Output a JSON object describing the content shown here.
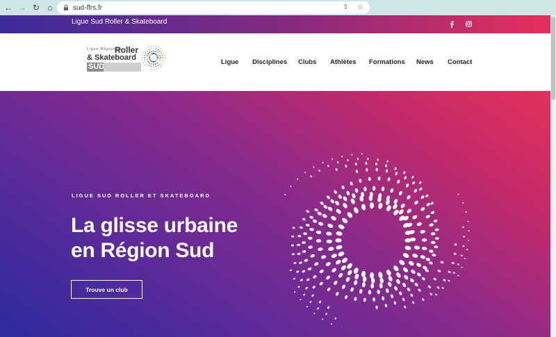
{
  "browser": {
    "url": "sud-ffrs.fr"
  },
  "site": {
    "topbar_title": "Ligue Sud Roller & Skateboard",
    "logo": {
      "line1": "Ligue Régionale",
      "roller": "Roller",
      "skateboard": "& Skateboard",
      "sud": "SUD"
    },
    "menu": [
      "Ligue",
      "Disciplines",
      "Clubs",
      "Athlètes",
      "Formations",
      "News",
      "Contact"
    ]
  },
  "hero": {
    "eyebrow": "LIGUE SUD ROLLER ET SKATEBOARD",
    "headline_line1": "La glisse urbaine",
    "headline_line2": "en Région Sud",
    "cta": "Trouve un club"
  },
  "colors": {
    "gradient_start": "#2b2a9e",
    "gradient_end": "#e33059"
  }
}
